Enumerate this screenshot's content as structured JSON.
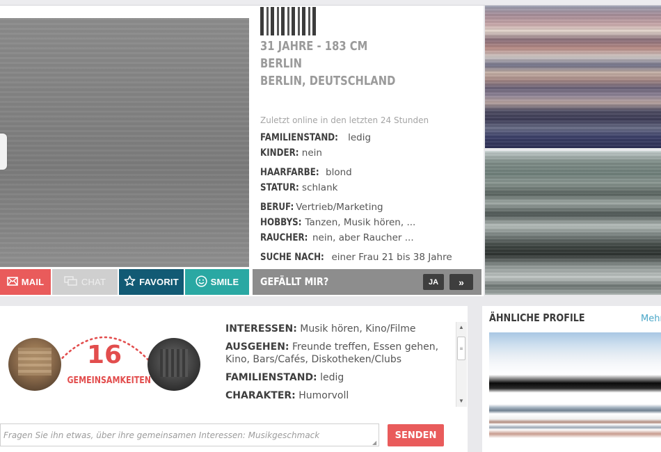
{
  "profile": {
    "age_height": "31 JAHRE - 183 CM",
    "city": "BERLIN",
    "region": "BERLIN, DEUTSCHLAND",
    "last_online": "Zuletzt online in den letzten 24 Stunden",
    "facts": [
      {
        "label": "FAMILIENSTAND:",
        "value": "ledig"
      },
      {
        "label": "KINDER:",
        "value": "nein"
      },
      {
        "label": "HAARFARBE:",
        "value": "blond"
      },
      {
        "label": "STATUR:",
        "value": "schlank"
      },
      {
        "label": "BERUF:",
        "value": "Vertrieb/Marketing"
      },
      {
        "label": "HOBBYS:",
        "value": "Tanzen, Musik hören, ..."
      },
      {
        "label": "RAUCHER:",
        "value": "nein, aber Raucher ..."
      },
      {
        "label": "SUCHE NACH:",
        "value": "einer Frau 21 bis 38 Jahre"
      }
    ]
  },
  "actions": {
    "mail": "MAIL",
    "chat": "CHAT",
    "favorit": "FAVORIT",
    "smile": "SMILE"
  },
  "like": {
    "label": "GEFÄLLT MIR?",
    "yes": "JA",
    "next": "»"
  },
  "common": {
    "count": "16",
    "label": "GEMEINSAMKEITEN",
    "facts": [
      {
        "label": "INTERESSEN:",
        "value": "Musik hören, Kino/Filme"
      },
      {
        "label": "AUSGEHEN:",
        "value": "Freunde treffen, Essen gehen, Kino, Bars/Cafés, Diskotheken/Clubs"
      },
      {
        "label": "FAMILIENSTAND:",
        "value": "ledig"
      },
      {
        "label": "CHARAKTER:",
        "value": "Humorvoll"
      }
    ]
  },
  "ask": {
    "placeholder": "Fragen Sie ihn etwas, über ihre gemeinsamen Interessen: Musikgeschmack",
    "send": "SENDEN"
  },
  "similar": {
    "title": "ÄHNLICHE PROFILE",
    "more": "Mehr"
  },
  "colors": {
    "accent_red": "#e95b5b",
    "favorit_blue": "#125a74",
    "smile_teal": "#2aa8a3",
    "link_blue": "#4aa7c8"
  },
  "icons": {
    "mail": "envelope-icon",
    "chat": "chat-bubbles-icon",
    "favorit": "star-icon",
    "smile": "smiley-icon"
  }
}
